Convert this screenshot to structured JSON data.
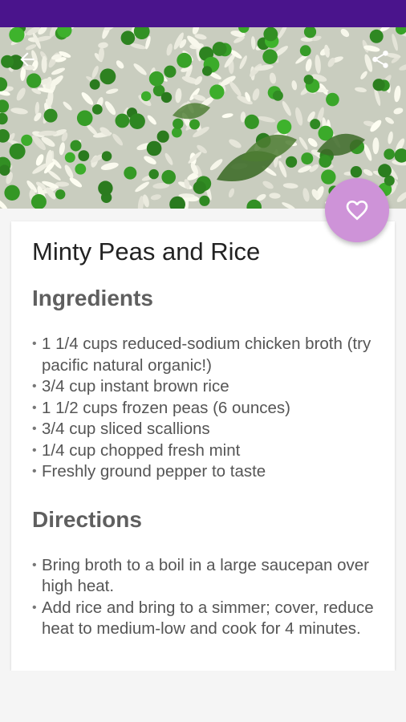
{
  "colors": {
    "status_bar": "#4a148c",
    "fab_background": "#ce93d8",
    "heading_text": "#5f5f5f",
    "body_text": "#555555"
  },
  "toolbar": {
    "back_icon": "arrow-back-icon",
    "share_icon": "share-icon"
  },
  "hero_image": {
    "description_icon": "peas-and-rice-photo"
  },
  "favorite_button": {
    "icon": "heart-outline-icon"
  },
  "recipe": {
    "title": "Minty Peas and Rice",
    "ingredients_heading": "Ingredients",
    "ingredients": [
      "1 1/4 cups reduced-sodium chicken broth (try pacific natural organic!)",
      "3/4 cup instant brown rice",
      "1 1/2 cups frozen peas (6 ounces)",
      "3/4 cup sliced scallions",
      "1/4 cup chopped fresh mint",
      "Freshly ground pepper to taste"
    ],
    "directions_heading": "Directions",
    "directions": [
      "Bring broth to a boil in a large saucepan over high heat.",
      "Add rice and bring to a simmer; cover, reduce heat to medium-low and cook for 4 minutes."
    ]
  }
}
